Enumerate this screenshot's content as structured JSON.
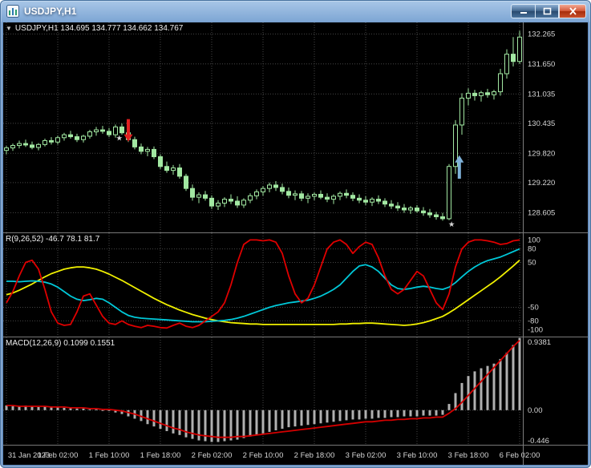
{
  "window": {
    "title": "USDJPY,H1",
    "buttons": {
      "minimize": "minimize",
      "maximize": "maximize",
      "close": "close"
    }
  },
  "icons": {
    "symbol_dropdown": "▼",
    "star": "★"
  },
  "colors": {
    "background": "#000000",
    "grid": "#464646",
    "candle": "#a2e8a2",
    "candle_fill_bull": "#000000",
    "scale_text": "#d6d6d6",
    "histogram": "#b0b0b0",
    "macd_signal": "#d40000",
    "osc_fast": "#e00000",
    "osc_medium": "#00c8d8",
    "osc_slow": "#f0f000",
    "arrow_red": "#e02020",
    "arrow_blue": "#7fb2d9"
  },
  "chart_data": [
    {
      "type": "candlestick",
      "title": "USDJPY,H1 134.695 134.777 134.662 134.767",
      "ylim": [
        128.2,
        132.5
      ],
      "y_ticks": [
        {
          "v": 132.265,
          "label": "132.265"
        },
        {
          "v": 131.65,
          "label": "131.650"
        },
        {
          "v": 131.035,
          "label": "131.035"
        },
        {
          "v": 130.435,
          "label": "130.435"
        },
        {
          "v": 129.82,
          "label": "129.820"
        },
        {
          "v": 129.22,
          "label": "129.220"
        },
        {
          "v": 128.605,
          "label": "128.605"
        }
      ],
      "x_tick_bars": [
        0,
        8,
        16,
        24,
        32,
        40,
        48,
        56,
        64,
        72,
        80
      ],
      "x_tick_labels": [
        "31 Jan 2023",
        "1 Feb 02:00",
        "1 Feb 10:00",
        "1 Feb 18:00",
        "2 Feb 02:00",
        "2 Feb 10:00",
        "2 Feb 18:00",
        "3 Feb 02:00",
        "3 Feb 10:00",
        "3 Feb 18:00",
        "6 Feb 02:00"
      ],
      "ohlc": [
        [
          129.88,
          129.97,
          129.8,
          129.93
        ],
        [
          129.93,
          130.02,
          129.87,
          129.98
        ],
        [
          129.98,
          130.08,
          129.92,
          130.02
        ],
        [
          130.02,
          130.1,
          129.95,
          129.99
        ],
        [
          129.99,
          130.06,
          129.9,
          129.94
        ],
        [
          129.94,
          130.03,
          129.88,
          130.0
        ],
        [
          130.0,
          130.12,
          129.96,
          130.08
        ],
        [
          130.08,
          130.15,
          130.0,
          130.05
        ],
        [
          130.05,
          130.18,
          130.0,
          130.14
        ],
        [
          130.14,
          130.24,
          130.08,
          130.2
        ],
        [
          130.2,
          130.28,
          130.12,
          130.16
        ],
        [
          130.16,
          130.22,
          130.05,
          130.1
        ],
        [
          130.1,
          130.2,
          130.04,
          130.17
        ],
        [
          130.17,
          130.3,
          130.12,
          130.26
        ],
        [
          130.26,
          130.36,
          130.18,
          130.3
        ],
        [
          130.3,
          130.38,
          130.22,
          130.27
        ],
        [
          130.27,
          130.34,
          130.15,
          130.2
        ],
        [
          130.2,
          130.41,
          130.14,
          130.36
        ],
        [
          130.36,
          130.43,
          130.2,
          130.24
        ],
        [
          130.24,
          130.3,
          130.05,
          130.1
        ],
        [
          130.1,
          130.16,
          129.9,
          129.95
        ],
        [
          129.95,
          130.02,
          129.8,
          129.86
        ],
        [
          129.86,
          129.95,
          129.76,
          129.9
        ],
        [
          129.9,
          129.96,
          129.7,
          129.75
        ],
        [
          129.75,
          129.8,
          129.5,
          129.55
        ],
        [
          129.55,
          129.65,
          129.42,
          129.47
        ],
        [
          129.47,
          129.58,
          129.38,
          129.52
        ],
        [
          129.52,
          129.6,
          129.3,
          129.35
        ],
        [
          129.35,
          129.4,
          129.05,
          129.1
        ],
        [
          129.1,
          129.18,
          128.85,
          128.92
        ],
        [
          128.92,
          129.02,
          128.8,
          128.97
        ],
        [
          128.97,
          129.05,
          128.85,
          128.9
        ],
        [
          128.9,
          128.96,
          128.68,
          128.74
        ],
        [
          128.74,
          128.86,
          128.66,
          128.8
        ],
        [
          128.8,
          128.92,
          128.72,
          128.88
        ],
        [
          128.88,
          128.98,
          128.78,
          128.84
        ],
        [
          128.84,
          128.94,
          128.7,
          128.76
        ],
        [
          128.76,
          128.9,
          128.7,
          128.86
        ],
        [
          128.86,
          129.0,
          128.8,
          128.95
        ],
        [
          128.95,
          129.08,
          128.88,
          129.03
        ],
        [
          129.03,
          129.15,
          128.95,
          129.1
        ],
        [
          129.1,
          129.22,
          129.02,
          129.17
        ],
        [
          129.17,
          129.25,
          129.05,
          129.12
        ],
        [
          129.12,
          129.2,
          128.98,
          129.04
        ],
        [
          129.04,
          129.12,
          128.9,
          128.96
        ],
        [
          128.96,
          129.06,
          128.86,
          128.99
        ],
        [
          128.99,
          129.05,
          128.84,
          128.9
        ],
        [
          128.9,
          129.0,
          128.8,
          128.94
        ],
        [
          128.94,
          129.02,
          128.86,
          128.98
        ],
        [
          128.98,
          129.06,
          128.88,
          128.92
        ],
        [
          128.92,
          129.0,
          128.82,
          128.88
        ],
        [
          128.88,
          128.98,
          128.78,
          128.94
        ],
        [
          128.94,
          129.04,
          128.86,
          129.0
        ],
        [
          129.0,
          129.08,
          128.9,
          128.96
        ],
        [
          128.96,
          129.02,
          128.84,
          128.9
        ],
        [
          128.9,
          128.98,
          128.8,
          128.86
        ],
        [
          128.86,
          128.94,
          128.76,
          128.82
        ],
        [
          128.82,
          128.92,
          128.74,
          128.88
        ],
        [
          128.88,
          128.96,
          128.78,
          128.84
        ],
        [
          128.84,
          128.9,
          128.72,
          128.78
        ],
        [
          128.78,
          128.86,
          128.68,
          128.74
        ],
        [
          128.74,
          128.82,
          128.64,
          128.7
        ],
        [
          128.7,
          128.78,
          128.6,
          128.66
        ],
        [
          128.66,
          128.74,
          128.58,
          128.7
        ],
        [
          128.7,
          128.76,
          128.6,
          128.64
        ],
        [
          128.64,
          128.72,
          128.54,
          128.6
        ],
        [
          128.6,
          128.68,
          128.5,
          128.56
        ],
        [
          128.56,
          128.62,
          128.46,
          128.52
        ],
        [
          128.52,
          128.6,
          128.44,
          128.48
        ],
        [
          128.48,
          129.6,
          128.45,
          129.55
        ],
        [
          129.55,
          130.5,
          129.4,
          130.4
        ],
        [
          130.4,
          131.05,
          130.2,
          130.95
        ],
        [
          130.95,
          131.15,
          130.8,
          131.05
        ],
        [
          131.05,
          131.12,
          130.9,
          131.0
        ],
        [
          131.0,
          131.1,
          130.88,
          131.06
        ],
        [
          131.06,
          131.14,
          130.96,
          131.02
        ],
        [
          131.02,
          131.12,
          130.92,
          131.08
        ],
        [
          131.08,
          131.55,
          131.0,
          131.45
        ],
        [
          131.45,
          131.95,
          131.35,
          131.85
        ],
        [
          131.85,
          132.2,
          131.6,
          131.7
        ],
        [
          131.7,
          132.33,
          131.65,
          132.2
        ]
      ],
      "annotations": [
        {
          "shape": "arrow-down",
          "color": "#e02020",
          "bar": 19,
          "tip_price": 130.06,
          "tail_price": 130.52
        },
        {
          "shape": "star",
          "color": "#e02020",
          "bar": 17.6,
          "price": 130.12,
          "size": 10
        },
        {
          "shape": "arrow-up",
          "color": "#7fb2d9",
          "bar": 70.6,
          "tip_price": 129.78,
          "tail_price": 129.3
        },
        {
          "shape": "star",
          "color": "#7fb2d9",
          "bar": 69.4,
          "price": 128.36,
          "size": 13
        }
      ]
    },
    {
      "type": "line",
      "title": "R(9,26,52) -46.7 78.1 81.7",
      "ylim": [
        -115,
        115
      ],
      "y_ticks": [
        100,
        80,
        50,
        -50,
        -80,
        -100
      ],
      "grid_levels": [
        80,
        50,
        -50,
        -80
      ],
      "series": [
        {
          "name": "fast",
          "color": "#e00000",
          "values": [
            -40,
            -15,
            20,
            50,
            55,
            35,
            -10,
            -60,
            -85,
            -90,
            -88,
            -60,
            -25,
            -20,
            -45,
            -70,
            -85,
            -88,
            -80,
            -88,
            -92,
            -95,
            -90,
            -92,
            -95,
            -96,
            -90,
            -85,
            -92,
            -95,
            -90,
            -80,
            -70,
            -60,
            -40,
            0,
            50,
            90,
            100,
            100,
            98,
            100,
            95,
            70,
            20,
            -20,
            -40,
            -30,
            0,
            40,
            80,
            95,
            100,
            90,
            70,
            85,
            95,
            90,
            60,
            20,
            -10,
            -20,
            -10,
            10,
            30,
            20,
            -10,
            -40,
            -55,
            -20,
            40,
            80,
            95,
            100,
            100,
            98,
            95,
            90,
            92,
            98,
            100
          ]
        },
        {
          "name": "medium",
          "color": "#00c8d8",
          "values": [
            8,
            8,
            7,
            8,
            9,
            8,
            6,
            2,
            -5,
            -15,
            -25,
            -32,
            -35,
            -33,
            -30,
            -32,
            -40,
            -50,
            -60,
            -68,
            -72,
            -74,
            -75,
            -76,
            -77,
            -78,
            -79,
            -80,
            -81,
            -82,
            -82,
            -82,
            -81,
            -80,
            -79,
            -77,
            -74,
            -70,
            -65,
            -60,
            -55,
            -50,
            -46,
            -43,
            -40,
            -38,
            -36,
            -34,
            -30,
            -25,
            -18,
            -10,
            0,
            15,
            30,
            42,
            45,
            40,
            30,
            15,
            0,
            -8,
            -10,
            -8,
            -5,
            -3,
            -5,
            -8,
            -10,
            -5,
            5,
            18,
            30,
            40,
            48,
            54,
            58,
            62,
            68,
            74,
            80
          ]
        },
        {
          "name": "slow",
          "color": "#f0f000",
          "values": [
            -22,
            -18,
            -12,
            -5,
            2,
            10,
            18,
            25,
            30,
            35,
            38,
            40,
            40,
            38,
            35,
            30,
            24,
            17,
            10,
            2,
            -6,
            -14,
            -22,
            -30,
            -37,
            -44,
            -50,
            -56,
            -61,
            -66,
            -70,
            -74,
            -77,
            -80,
            -82,
            -84,
            -85,
            -86,
            -87,
            -87,
            -88,
            -88,
            -88,
            -88,
            -88,
            -88,
            -88,
            -88,
            -88,
            -88,
            -88,
            -88,
            -87,
            -87,
            -86,
            -86,
            -85,
            -85,
            -86,
            -87,
            -88,
            -89,
            -90,
            -89,
            -87,
            -84,
            -80,
            -75,
            -70,
            -62,
            -53,
            -43,
            -33,
            -23,
            -13,
            -3,
            7,
            18,
            30,
            42,
            55
          ]
        }
      ]
    },
    {
      "type": "macd",
      "title": "MACD(12,26,9) 0.1099 0.1551",
      "ylim": [
        -0.446,
        0.9381
      ],
      "y_ticks": [
        {
          "v": 0.9381,
          "label": "0.9381"
        },
        {
          "v": 0,
          "label": "0.00"
        },
        {
          "v": -0.446,
          "label": "-0.446"
        }
      ],
      "histogram": [
        0.06,
        0.05,
        0.05,
        0.06,
        0.05,
        0.04,
        0.05,
        0.04,
        0.04,
        0.03,
        0.03,
        0.02,
        0.02,
        0.01,
        0.01,
        0.0,
        -0.01,
        -0.03,
        -0.05,
        -0.08,
        -0.11,
        -0.14,
        -0.18,
        -0.21,
        -0.24,
        -0.27,
        -0.3,
        -0.32,
        -0.35,
        -0.37,
        -0.39,
        -0.4,
        -0.41,
        -0.41,
        -0.4,
        -0.39,
        -0.38,
        -0.36,
        -0.34,
        -0.32,
        -0.3,
        -0.28,
        -0.26,
        -0.24,
        -0.22,
        -0.21,
        -0.2,
        -0.19,
        -0.18,
        -0.17,
        -0.16,
        -0.15,
        -0.14,
        -0.13,
        -0.12,
        -0.12,
        -0.11,
        -0.11,
        -0.1,
        -0.1,
        -0.09,
        -0.09,
        -0.08,
        -0.08,
        -0.08,
        -0.07,
        -0.07,
        -0.07,
        -0.06,
        0.08,
        0.22,
        0.35,
        0.44,
        0.5,
        0.54,
        0.57,
        0.6,
        0.66,
        0.74,
        0.84,
        0.93
      ],
      "signal": {
        "name": "signal",
        "color": "#d40000",
        "values": [
          0.06,
          0.06,
          0.05,
          0.05,
          0.05,
          0.05,
          0.05,
          0.04,
          0.04,
          0.04,
          0.03,
          0.03,
          0.03,
          0.02,
          0.02,
          0.01,
          0.01,
          0.0,
          -0.01,
          -0.03,
          -0.05,
          -0.08,
          -0.11,
          -0.14,
          -0.17,
          -0.2,
          -0.23,
          -0.25,
          -0.28,
          -0.3,
          -0.32,
          -0.33,
          -0.34,
          -0.35,
          -0.35,
          -0.35,
          -0.34,
          -0.34,
          -0.33,
          -0.32,
          -0.31,
          -0.3,
          -0.29,
          -0.28,
          -0.27,
          -0.26,
          -0.25,
          -0.24,
          -0.23,
          -0.22,
          -0.21,
          -0.2,
          -0.19,
          -0.18,
          -0.17,
          -0.16,
          -0.15,
          -0.15,
          -0.14,
          -0.13,
          -0.13,
          -0.12,
          -0.12,
          -0.11,
          -0.11,
          -0.1,
          -0.1,
          -0.09,
          -0.09,
          -0.04,
          0.02,
          0.1,
          0.19,
          0.28,
          0.37,
          0.46,
          0.55,
          0.64,
          0.73,
          0.82,
          0.9
        ]
      }
    }
  ]
}
